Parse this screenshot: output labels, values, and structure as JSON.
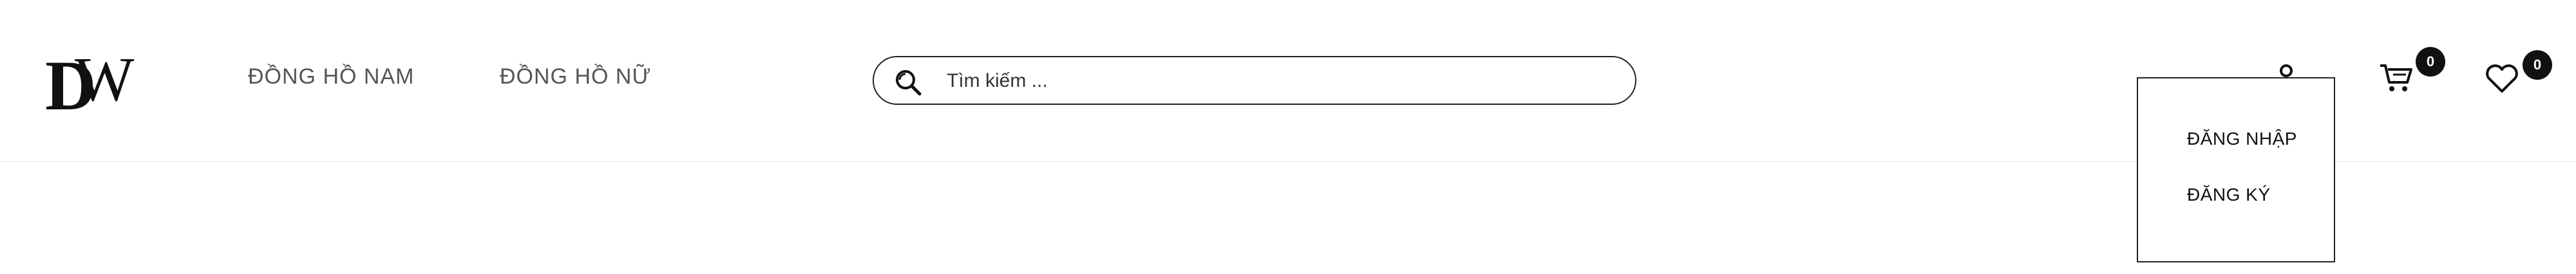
{
  "header": {
    "logo_text": "DW",
    "nav": [
      {
        "label": "ĐỒNG HỒ NAM"
      },
      {
        "label": "ĐỒNG HỒ NỮ"
      }
    ],
    "search": {
      "placeholder": "Tìm kiếm ...",
      "value": ""
    },
    "cart": {
      "count": "0"
    },
    "wishlist": {
      "count": "0"
    }
  },
  "account_dropdown": {
    "items": [
      {
        "label": "ĐĂNG NHẬP"
      },
      {
        "label": "ĐĂNG KÝ"
      }
    ]
  },
  "icons": {
    "search": "search-icon",
    "user": "user-icon",
    "cart": "cart-icon",
    "wishlist": "heart-icon"
  }
}
